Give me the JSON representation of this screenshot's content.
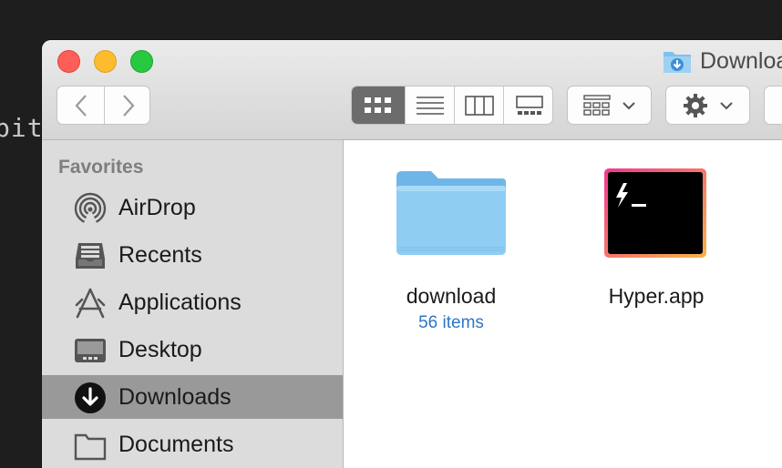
{
  "background": {
    "terminal_text": "bit"
  },
  "window": {
    "title": "Downloa",
    "toolbar": {
      "back_icon": "chevron-left-icon",
      "forward_icon": "chevron-right-icon",
      "view_modes": [
        "icon-view",
        "list-view",
        "column-view",
        "gallery-view"
      ],
      "active_view": "icon-view",
      "group_icon": "group-grid-icon",
      "action_icon": "gear-icon"
    },
    "sidebar": {
      "section_title": "Favorites",
      "items": [
        {
          "label": "AirDrop",
          "icon": "airdrop-icon"
        },
        {
          "label": "Recents",
          "icon": "recents-icon"
        },
        {
          "label": "Applications",
          "icon": "applications-icon"
        },
        {
          "label": "Desktop",
          "icon": "desktop-icon"
        },
        {
          "label": "Downloads",
          "icon": "downloads-icon",
          "selected": true
        },
        {
          "label": "Documents",
          "icon": "documents-icon"
        }
      ]
    },
    "files": [
      {
        "name": "download",
        "detail": "56 items",
        "icon": "folder-icon"
      },
      {
        "name": "Hyper.app",
        "icon": "hyper-app-icon"
      }
    ]
  },
  "colors": {
    "accent_blue": "#2f74c8",
    "folder_blue": "#87c8f0",
    "selection": "#999999"
  }
}
